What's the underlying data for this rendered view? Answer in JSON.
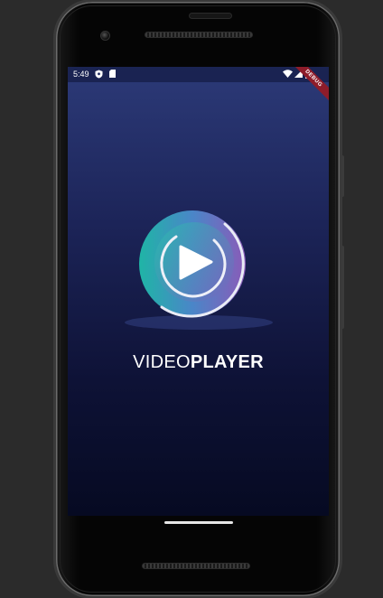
{
  "status_bar": {
    "time": "5:49",
    "left_icons": [
      "shield-icon",
      "sd-card-icon"
    ],
    "right_icons": [
      "wifi-icon",
      "signal-icon",
      "battery-icon"
    ],
    "debug_banner": "DEBUG"
  },
  "splash": {
    "title_light": "VIDEO",
    "title_bold": "PLAYER",
    "logo_icon": "play-icon"
  },
  "colors": {
    "background_top": "#2c3a78",
    "background_bottom": "#060a22",
    "logo_gradient_start": "#1fb5a6",
    "logo_gradient_end": "#8a5bb8",
    "debug_ribbon": "#8e1c2a"
  }
}
